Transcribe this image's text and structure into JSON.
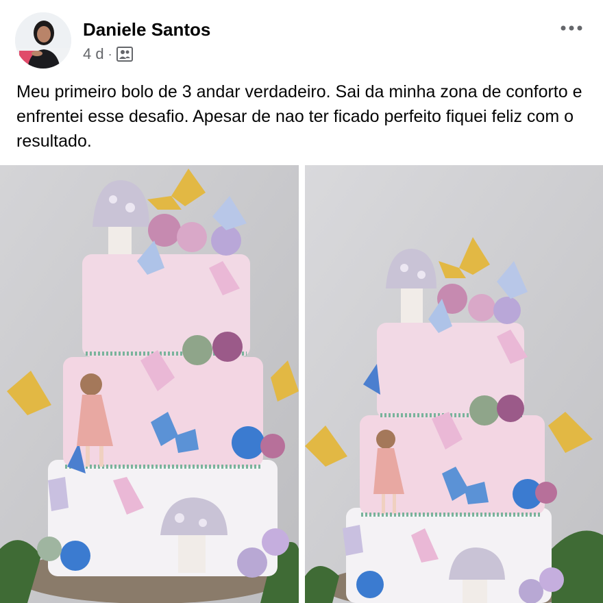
{
  "post": {
    "author": "Daniele Santos",
    "time": "4 d",
    "separator": "·",
    "audience_icon": "friends-icon",
    "more_icon": "more-options-icon",
    "text": "Meu primeiro bolo de 3 andar verdadeiro. Sai da minha zona de conforto e enfrentei esse desafio. Apesar de nao ter ficado perfeito fiquei feliz com o resultado."
  },
  "colors": {
    "text": "#050505",
    "meta": "#65676b",
    "cake_pink": "#f3d6e3",
    "cake_white": "#f4f2f5",
    "background_gray": "#c9c9cc"
  }
}
